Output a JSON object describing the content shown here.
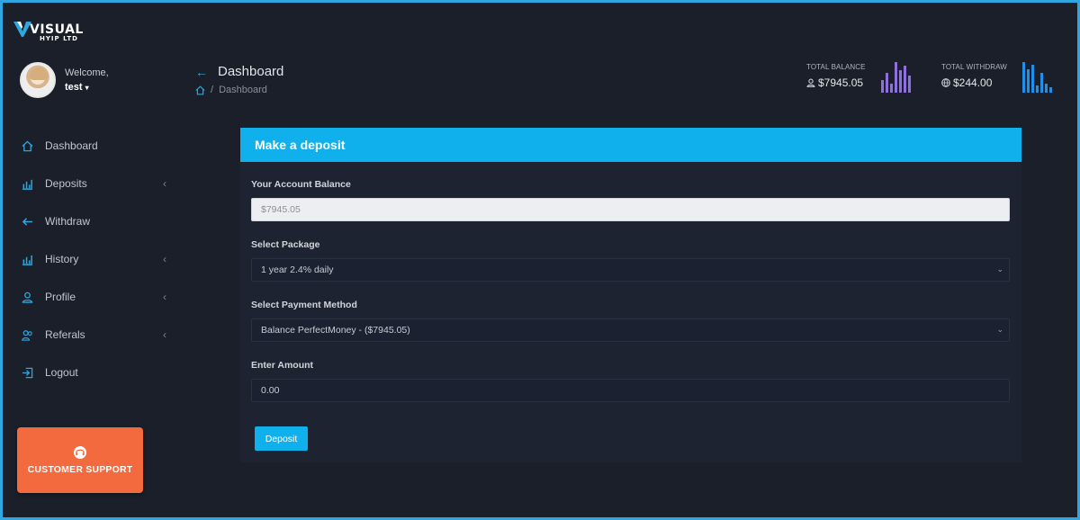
{
  "brand": {
    "name": "VISUAL",
    "tagline": "HYIP LTD"
  },
  "user": {
    "welcome": "Welcome,",
    "name": "test",
    "caret": "▾"
  },
  "sidebar": {
    "items": [
      {
        "label": "Dashboard",
        "icon": "home-icon",
        "has_submenu": false
      },
      {
        "label": "Deposits",
        "icon": "bar-chart-icon",
        "has_submenu": true
      },
      {
        "label": "Withdraw",
        "icon": "arrow-left-icon",
        "has_submenu": false
      },
      {
        "label": "History",
        "icon": "bar-chart-icon",
        "has_submenu": true
      },
      {
        "label": "Profile",
        "icon": "user-icon",
        "has_submenu": true
      },
      {
        "label": "Referals",
        "icon": "users-icon",
        "has_submenu": true
      },
      {
        "label": "Logout",
        "icon": "logout-icon",
        "has_submenu": false
      }
    ],
    "chevron": "‹",
    "support_label": "CUSTOMER SUPPORT"
  },
  "header": {
    "title": "Dashboard",
    "breadcrumb": {
      "separator": "/",
      "current": "Dashboard"
    }
  },
  "stats": {
    "balance": {
      "label": "TOTAL BALANCE",
      "value": "$7945.05",
      "color": "#8f6fe0"
    },
    "withdraw": {
      "label": "TOTAL WITHDRAW",
      "value": "$244.00",
      "color": "#1f8fe8"
    }
  },
  "deposit_form": {
    "title": "Make a deposit",
    "balance_label": "Your Account Balance",
    "balance_value": "$7945.05",
    "package_label": "Select Package",
    "package_value": "1 year 2.4% daily",
    "payment_label": "Select Payment Method",
    "payment_value": "Balance PerfectMoney - ($7945.05)",
    "amount_label": "Enter Amount",
    "amount_value": "0.00",
    "submit_label": "Deposit"
  },
  "colors": {
    "accent": "#0fb0ec",
    "support": "#f26a3e",
    "background": "#1a1f29"
  }
}
